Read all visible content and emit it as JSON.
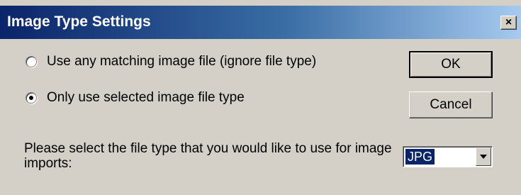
{
  "window": {
    "title": "Image Type Settings",
    "close_glyph": "×"
  },
  "options": {
    "any_matching": {
      "label": "Use any matching image file (ignore file type)",
      "checked": false
    },
    "selected_type": {
      "label": "Only use selected image file type",
      "checked": true
    }
  },
  "buttons": {
    "ok_label": "OK",
    "cancel_label": "Cancel"
  },
  "file_type": {
    "prompt": "Please select the file type that you would like to use for image imports:",
    "selected_value": "JPG"
  },
  "colors": {
    "title_bar_start": "#0a246a",
    "title_bar_end": "#a6caf0",
    "dialog_face": "#d4d0c8",
    "selection_highlight": "#0a246a"
  }
}
